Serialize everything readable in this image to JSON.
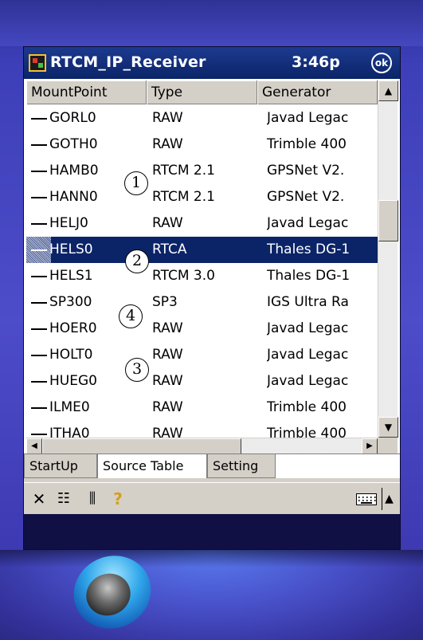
{
  "window": {
    "title": "RTCM_IP_Receiver",
    "time": "3:46p",
    "ok_label": "ok"
  },
  "columns": [
    "MountPoint",
    "Type",
    "Generator"
  ],
  "rows": [
    {
      "mountpoint": "GORL0",
      "type": "RAW",
      "generator": "Javad Legac"
    },
    {
      "mountpoint": "GOTH0",
      "type": "RAW",
      "generator": "Trimble 400"
    },
    {
      "mountpoint": "HAMB0",
      "type": "RTCM 2.1",
      "generator": "GPSNet V2."
    },
    {
      "mountpoint": "HANN0",
      "type": "RTCM 2.1",
      "generator": "GPSNet V2."
    },
    {
      "mountpoint": "HELJ0",
      "type": "RAW",
      "generator": "Javad Legac"
    },
    {
      "mountpoint": "HELS0",
      "type": "RTCA",
      "generator": "Thales DG-1",
      "selected": true
    },
    {
      "mountpoint": "HELS1",
      "type": "RTCM 3.0",
      "generator": "Thales DG-1"
    },
    {
      "mountpoint": "SP300",
      "type": "SP3",
      "generator": "IGS Ultra Ra"
    },
    {
      "mountpoint": "HOER0",
      "type": "RAW",
      "generator": "Javad Legac"
    },
    {
      "mountpoint": "HOLT0",
      "type": "RAW",
      "generator": "Javad Legac"
    },
    {
      "mountpoint": "HUEG0",
      "type": "RAW",
      "generator": "Javad Legac"
    },
    {
      "mountpoint": "ILME0",
      "type": "RAW",
      "generator": "Trimble 400"
    },
    {
      "mountpoint": "ITHA0",
      "type": "RAW",
      "generator": "Trimble 400"
    }
  ],
  "annotations": [
    "1",
    "2",
    "4",
    "3"
  ],
  "tabs": [
    {
      "label": "StartUp",
      "active": false
    },
    {
      "label": "Source Table",
      "active": true
    },
    {
      "label": "Setting",
      "active": false
    }
  ],
  "command_bar": {
    "icons": [
      "close-icon",
      "list-icon",
      "columns-icon",
      "help-icon",
      "keyboard-icon",
      "up-arrow-icon"
    ],
    "close_glyph": "✕",
    "list_glyph": "☷",
    "columns_glyph": "⫼",
    "help_glyph": "?",
    "up_glyph": "▲"
  },
  "scrollbar_glyphs": {
    "up": "▲",
    "down": "▼",
    "left": "◀",
    "right": "▶"
  },
  "colors": {
    "selection": "#0b2468",
    "titlebar": "#0b2468",
    "device": "#4a4ac8",
    "help_icon": "#d2a11b"
  }
}
